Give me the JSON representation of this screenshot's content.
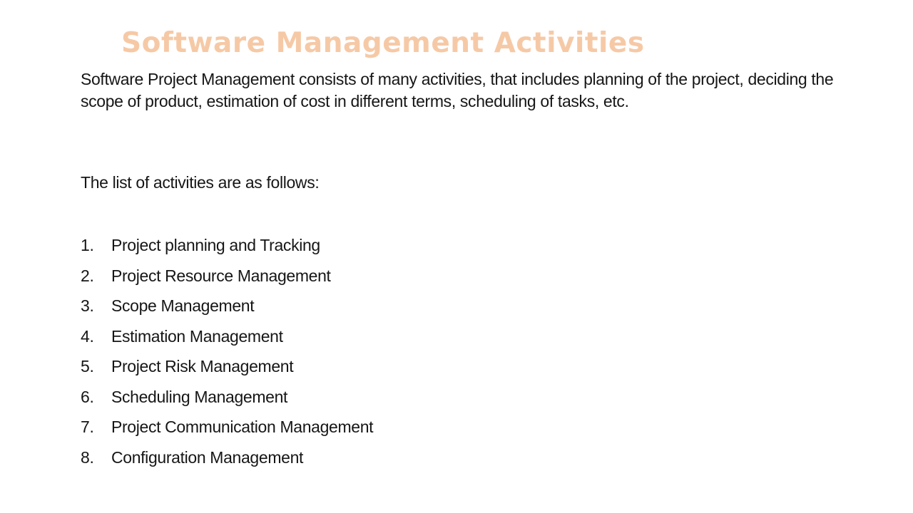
{
  "slide": {
    "title": "Software Management Activities",
    "intro": "Software Project Management consists of many activities, that includes planning of the project, deciding the scope of product, estimation of cost in different terms, scheduling of tasks, etc.",
    "lead": "The list of activities are as follows:",
    "activities": [
      {
        "number": "1.",
        "label": "Project planning and Tracking"
      },
      {
        "number": "2.",
        "label": "Project Resource Management"
      },
      {
        "number": "3.",
        "label": "Scope Management"
      },
      {
        "number": "4.",
        "label": "Estimation Management"
      },
      {
        "number": "5.",
        "label": "Project Risk Management"
      },
      {
        "number": "6.",
        "label": "Scheduling Management"
      },
      {
        "number": "7.",
        "label": "Project Communication Management"
      },
      {
        "number": "8.",
        "label": "Configuration Management"
      }
    ]
  },
  "colors": {
    "title": "#F6C9A6",
    "text": "#161616",
    "background": "#FFFFFF"
  }
}
